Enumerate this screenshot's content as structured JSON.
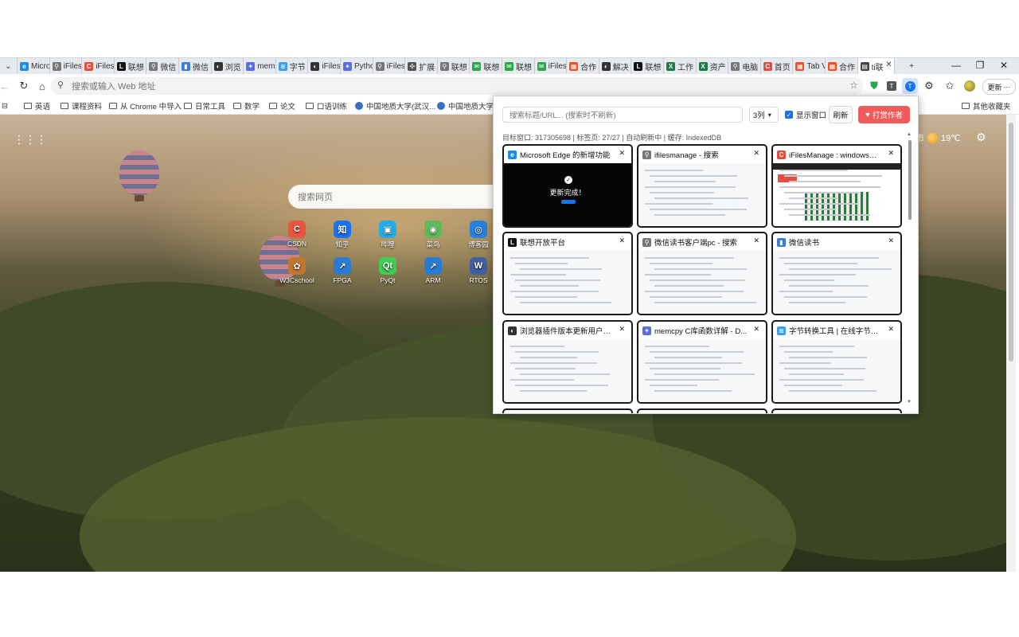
{
  "tabs": [
    {
      "label": "Micro",
      "icon": "edge-icon",
      "color": "#1a8ee8"
    },
    {
      "label": "iFiles",
      "icon": "search-icon",
      "color": "#777777"
    },
    {
      "label": "iFiles",
      "icon": "csdn-icon",
      "color": "#e74c3c"
    },
    {
      "label": "联想",
      "icon": "lenovo-l-icon",
      "color": "#111111"
    },
    {
      "label": "微信",
      "icon": "search-icon",
      "color": "#777777"
    },
    {
      "label": "微信",
      "icon": "weread-icon",
      "color": "#3a7bd5"
    },
    {
      "label": "浏览",
      "icon": "github-icon",
      "color": "#333333"
    },
    {
      "label": "mem",
      "icon": "cpp-icon",
      "color": "#5a6ee8"
    },
    {
      "label": "字节",
      "icon": "tool-icon",
      "color": "#3aa0e8"
    },
    {
      "label": "iFiles",
      "icon": "github-icon",
      "color": "#333333"
    },
    {
      "label": "Pytho",
      "icon": "cpp-icon",
      "color": "#5a6ee8"
    },
    {
      "label": "iFiles",
      "icon": "search-icon",
      "color": "#777777"
    },
    {
      "label": "扩展",
      "icon": "extension-icon",
      "color": "#555555"
    },
    {
      "label": "联想",
      "icon": "search-icon",
      "color": "#777777"
    },
    {
      "label": "联想",
      "icon": "mail-icon",
      "color": "#2aa84a"
    },
    {
      "label": "联想",
      "icon": "mail-icon",
      "color": "#2aa84a"
    },
    {
      "label": "iFiles",
      "icon": "mail-icon",
      "color": "#2aa84a"
    },
    {
      "label": "合作",
      "icon": "ms-icon",
      "color": "#f25022"
    },
    {
      "label": "解决",
      "icon": "github-icon",
      "color": "#333333"
    },
    {
      "label": "联想",
      "icon": "lenovo-l-icon",
      "color": "#111111"
    },
    {
      "label": "工作",
      "icon": "excel-icon",
      "color": "#1d7a45"
    },
    {
      "label": "资产",
      "icon": "excel-icon",
      "color": "#1d7a45"
    },
    {
      "label": "电脑",
      "icon": "search-icon",
      "color": "#777777"
    },
    {
      "label": "首页",
      "icon": "csdn-icon",
      "color": "#e74c3c"
    },
    {
      "label": "Tab V",
      "icon": "ms-icon",
      "color": "#f25022"
    },
    {
      "label": "合作",
      "icon": "ms-icon",
      "color": "#f25022"
    },
    {
      "label": "ti联",
      "icon": "newtab-icon",
      "color": "#444444"
    }
  ],
  "toolbar": {
    "omnibox_placeholder": "搜索或输入 Web 地址",
    "update_label": "更新"
  },
  "bookmarks": [
    {
      "label": "英语",
      "type": "folder"
    },
    {
      "label": "课程资料",
      "type": "folder"
    },
    {
      "label": "从 Chrome 中导入",
      "type": "folder"
    },
    {
      "label": "日常工具",
      "type": "folder"
    },
    {
      "label": "数学",
      "type": "folder"
    },
    {
      "label": "论文",
      "type": "folder"
    },
    {
      "label": "口语训练",
      "type": "folder"
    },
    {
      "label": "中国地质大学(武汉...",
      "type": "link"
    },
    {
      "label": "中国地质大学",
      "type": "link"
    }
  ],
  "bookmarks_other": "其他收藏夹",
  "ntp": {
    "search_placeholder": "搜索网页",
    "weather_city": "市",
    "temperature": "19℃",
    "shortcuts": [
      {
        "label": "CSDN",
        "glyph": "C",
        "color": "#e8563f"
      },
      {
        "label": "知乎",
        "glyph": "知",
        "color": "#1772f6"
      },
      {
        "label": "哔哩",
        "glyph": "▣",
        "color": "#23ade5"
      },
      {
        "label": "菜鸟",
        "glyph": "◉",
        "color": "#5fb85a"
      },
      {
        "label": "博客园",
        "glyph": "◎",
        "color": "#2980d9"
      },
      {
        "label": "W3Cschool",
        "glyph": "✿",
        "color": "#c2762f"
      },
      {
        "label": "FPGA",
        "glyph": "↗",
        "color": "#2b7bd3"
      },
      {
        "label": "PyQt",
        "glyph": "Qt",
        "color": "#41cd52"
      },
      {
        "label": "ARM",
        "glyph": "↗",
        "color": "#2b7bd3"
      },
      {
        "label": "RTOS",
        "glyph": "W",
        "color": "#3f5f9f"
      }
    ]
  },
  "popup": {
    "search_placeholder": "搜索标题/URL... (搜索时不刷新)",
    "columns_value": "3列",
    "show_window_label": "显示窗口",
    "show_window_checked": true,
    "refresh_label": "刷新",
    "donate_label": "打赏作者",
    "status_text": "目标窗口: 317305698 | 标签页: 27/27 | 自动刷新中 | 缓存: IndexedDB",
    "cards": [
      {
        "title": "Microsoft Edge 的新增功能",
        "icon": "edge-icon",
        "icon_color": "#1a8ee8",
        "thumb": "dark",
        "thumb_text": "更新完成！"
      },
      {
        "title": "ifilesmanage - 搜索",
        "icon": "search-icon",
        "icon_color": "#777777",
        "thumb": "light"
      },
      {
        "title": "iFilesManage : windows系...",
        "icon": "csdn-icon",
        "icon_color": "#e74c3c",
        "thumb": "mixed"
      },
      {
        "title": "联想开放平台",
        "icon": "lenovo-l-icon",
        "icon_color": "#111111",
        "thumb": "light"
      },
      {
        "title": "微信读书客户端pc - 搜索",
        "icon": "search-icon",
        "icon_color": "#777777",
        "thumb": "light"
      },
      {
        "title": "微信读书",
        "icon": "weread-icon",
        "icon_color": "#3a7bd5",
        "thumb": "light"
      },
      {
        "title": "浏览器插件版本更新用户是否...",
        "icon": "github-icon",
        "icon_color": "#333333",
        "thumb": "light"
      },
      {
        "title": "memcpy C库函数详解 - D...",
        "icon": "cpp-icon",
        "icon_color": "#5a6ee8",
        "thumb": "light"
      },
      {
        "title": "字节转换工具 | 在线字节大小...",
        "icon": "tool-icon",
        "icon_color": "#3aa0e8",
        "thumb": "light"
      }
    ]
  }
}
